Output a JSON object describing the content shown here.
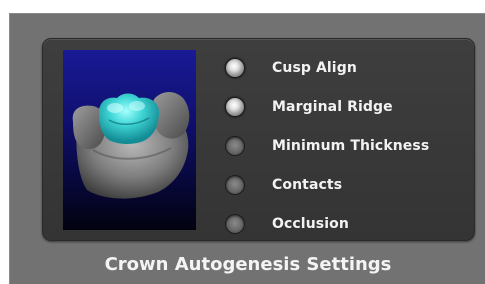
{
  "panel": {
    "title": "Crown Autogenesis Settings",
    "preview_icon": "tooth-crown-3d-preview",
    "options": [
      {
        "label": "Cusp Align",
        "selected": true
      },
      {
        "label": "Marginal Ridge",
        "selected": true
      },
      {
        "label": "Minimum Thickness",
        "selected": false
      },
      {
        "label": "Contacts",
        "selected": false
      },
      {
        "label": "Occlusion",
        "selected": false
      }
    ]
  },
  "colors": {
    "frame": "#727272",
    "panel": "#3a3a3a",
    "crown": "#3fd6d6",
    "viewport_top": "#1a1a96",
    "viewport_bottom": "#02020f"
  }
}
